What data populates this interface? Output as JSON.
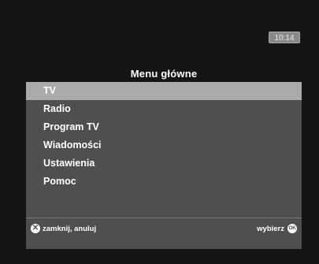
{
  "clock": {
    "time": "10:14"
  },
  "menu": {
    "title": "Menu główne",
    "items": [
      {
        "label": "TV",
        "selected": true
      },
      {
        "label": "Radio",
        "selected": false
      },
      {
        "label": "Program TV",
        "selected": false
      },
      {
        "label": "Wiadomości",
        "selected": false
      },
      {
        "label": "Ustawienia",
        "selected": false
      },
      {
        "label": "Pomoc",
        "selected": false
      }
    ]
  },
  "footer": {
    "close_label": "zamknij, anuluj",
    "close_icon": "close-x-icon",
    "select_label": "wybierz",
    "select_icon": "ok-icon",
    "ok_glyph": "OK"
  },
  "colors": {
    "background": "#151515",
    "panel": "#4f4f4f",
    "selected_row": "#aaaaaa",
    "text": "#ffffff",
    "clock_box": "#8a8a8a"
  }
}
